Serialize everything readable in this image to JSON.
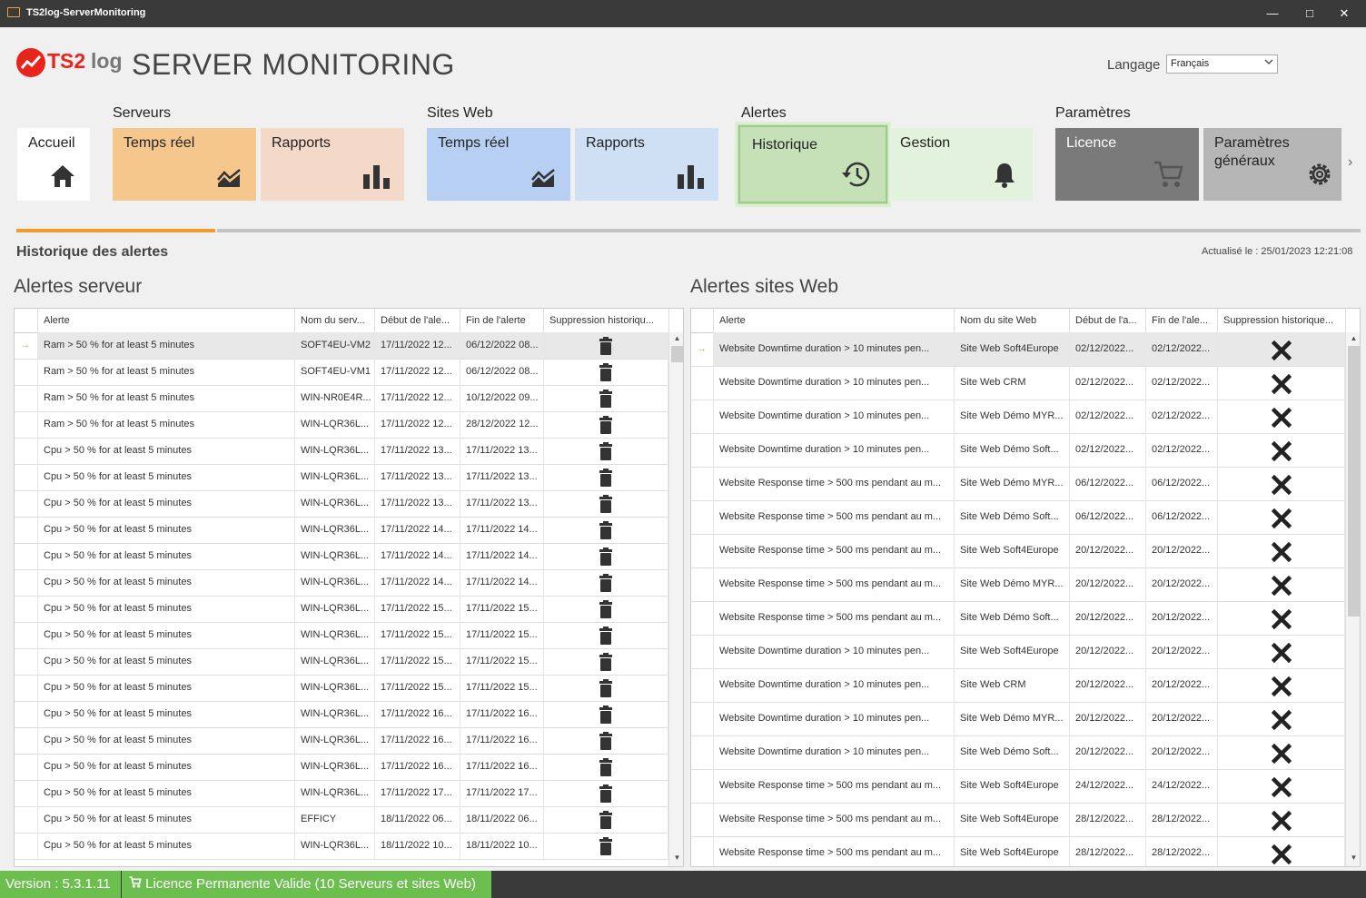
{
  "window": {
    "title": "TS2log-ServerMonitoring"
  },
  "header": {
    "logo_ts2": "TS2",
    "logo_log": "log",
    "title": "SERVER MONITORING",
    "language_label": "Langage",
    "language_value": "Français"
  },
  "groups": {
    "serveurs": "Serveurs",
    "sites": "Sites Web",
    "alertes": "Alertes",
    "parametres": "Paramètres"
  },
  "tiles": {
    "accueil": "Accueil",
    "srv_temps_reel": "Temps réel",
    "srv_rapports": "Rapports",
    "web_temps_reel": "Temps réel",
    "web_rapports": "Rapports",
    "historique": "Historique",
    "gestion": "Gestion",
    "licence": "Licence",
    "parametres_1": "Paramètres",
    "parametres_2": "généraux"
  },
  "colors": {
    "orange_tile": "#f6c78d",
    "orange_light": "#f4d9c8",
    "blue_tile": "#b6cff3",
    "blue_light": "#cfe0f5",
    "green_tile": "#c6e0b8",
    "green_light": "#e2f2dc",
    "grey_tile": "#7a7a7a",
    "grey_light": "#b6b6b6",
    "accent": "#f09b2b",
    "status_green": "#6cbf4f"
  },
  "section": {
    "title": "Historique des alertes",
    "updated": "Actualisé le : 25/01/2023 12:21:08"
  },
  "server_alerts": {
    "title": "Alertes serveur",
    "headers": [
      "Alerte",
      "Nom du serv...",
      "Début de l'ale...",
      "Fin de l'alerte",
      "Suppression historiqu..."
    ],
    "rows": [
      [
        "Ram > 50 % for at least 5 minutes",
        "SOFT4EU-VM2",
        "17/11/2022 12...",
        "06/12/2022 08..."
      ],
      [
        "Ram > 50 % for at least 5 minutes",
        "SOFT4EU-VM1",
        "17/11/2022 12...",
        "06/12/2022 08..."
      ],
      [
        "Ram > 50 % for at least 5 minutes",
        "WIN-NR0E4R...",
        "17/11/2022 12...",
        "10/12/2022 09..."
      ],
      [
        "Ram > 50 % for at least 5 minutes",
        "WIN-LQR36L...",
        "17/11/2022 12...",
        "28/12/2022 12..."
      ],
      [
        "Cpu > 50 % for at least 5 minutes",
        "WIN-LQR36L...",
        "17/11/2022 13...",
        "17/11/2022 13..."
      ],
      [
        "Cpu > 50 % for at least 5 minutes",
        "WIN-LQR36L...",
        "17/11/2022 13...",
        "17/11/2022 13..."
      ],
      [
        "Cpu > 50 % for at least 5 minutes",
        "WIN-LQR36L...",
        "17/11/2022 13...",
        "17/11/2022 13..."
      ],
      [
        "Cpu > 50 % for at least 5 minutes",
        "WIN-LQR36L...",
        "17/11/2022 14...",
        "17/11/2022 14..."
      ],
      [
        "Cpu > 50 % for at least 5 minutes",
        "WIN-LQR36L...",
        "17/11/2022 14...",
        "17/11/2022 14..."
      ],
      [
        "Cpu > 50 % for at least 5 minutes",
        "WIN-LQR36L...",
        "17/11/2022 14...",
        "17/11/2022 14..."
      ],
      [
        "Cpu > 50 % for at least 5 minutes",
        "WIN-LQR36L...",
        "17/11/2022 15...",
        "17/11/2022 15..."
      ],
      [
        "Cpu > 50 % for at least 5 minutes",
        "WIN-LQR36L...",
        "17/11/2022 15...",
        "17/11/2022 15..."
      ],
      [
        "Cpu > 50 % for at least 5 minutes",
        "WIN-LQR36L...",
        "17/11/2022 15...",
        "17/11/2022 15..."
      ],
      [
        "Cpu > 50 % for at least 5 minutes",
        "WIN-LQR36L...",
        "17/11/2022 15...",
        "17/11/2022 15..."
      ],
      [
        "Cpu > 50 % for at least 5 minutes",
        "WIN-LQR36L...",
        "17/11/2022 16...",
        "17/11/2022 16..."
      ],
      [
        "Cpu > 50 % for at least 5 minutes",
        "WIN-LQR36L...",
        "17/11/2022 16...",
        "17/11/2022 16..."
      ],
      [
        "Cpu > 50 % for at least 5 minutes",
        "WIN-LQR36L...",
        "17/11/2022 16...",
        "17/11/2022 16..."
      ],
      [
        "Cpu > 50 % for at least 5 minutes",
        "WIN-LQR36L...",
        "17/11/2022 17...",
        "17/11/2022 17..."
      ],
      [
        "Cpu > 50 % for at least 5 minutes",
        "EFFICY",
        "18/11/2022 06...",
        "18/11/2022 06..."
      ],
      [
        "Cpu > 50 % for at least 5 minutes",
        "WIN-LQR36L...",
        "18/11/2022 10...",
        "18/11/2022 10..."
      ]
    ]
  },
  "web_alerts": {
    "title": "Alertes sites Web",
    "headers": [
      "Alerte",
      "Nom du site Web",
      "Début de l'a...",
      "Fin de l'ale...",
      "Suppression historique..."
    ],
    "rows": [
      [
        "Website Downtime duration > 10 minutes pen...",
        "Site Web Soft4Europe",
        "02/12/2022...",
        "02/12/2022..."
      ],
      [
        "Website Downtime duration > 10 minutes pen...",
        "Site Web CRM",
        "02/12/2022...",
        "02/12/2022..."
      ],
      [
        "Website Downtime duration > 10 minutes pen...",
        "Site Web Démo MYR...",
        "02/12/2022...",
        "02/12/2022..."
      ],
      [
        "Website Downtime duration > 10 minutes pen...",
        "Site Web Démo Soft...",
        "02/12/2022...",
        "02/12/2022..."
      ],
      [
        "Website Response time > 500 ms pendant au m...",
        "Site Web Démo MYR...",
        "06/12/2022...",
        "06/12/2022..."
      ],
      [
        "Website Response time > 500 ms pendant au m...",
        "Site Web Démo Soft...",
        "06/12/2022...",
        "06/12/2022..."
      ],
      [
        "Website Response time > 500 ms pendant au m...",
        "Site Web Soft4Europe",
        "20/12/2022...",
        "20/12/2022..."
      ],
      [
        "Website Response time > 500 ms pendant au m...",
        "Site Web Démo MYR...",
        "20/12/2022...",
        "20/12/2022..."
      ],
      [
        "Website Response time > 500 ms pendant au m...",
        "Site Web Démo Soft...",
        "20/12/2022...",
        "20/12/2022..."
      ],
      [
        "Website Downtime duration > 10 minutes pen...",
        "Site Web Soft4Europe",
        "20/12/2022...",
        "20/12/2022..."
      ],
      [
        "Website Downtime duration > 10 minutes pen...",
        "Site Web CRM",
        "20/12/2022...",
        "20/12/2022..."
      ],
      [
        "Website Downtime duration > 10 minutes pen...",
        "Site Web Démo MYR...",
        "20/12/2022...",
        "20/12/2022..."
      ],
      [
        "Website Downtime duration > 10 minutes pen...",
        "Site Web Démo Soft...",
        "20/12/2022...",
        "20/12/2022..."
      ],
      [
        "Website Response time > 500 ms pendant au m...",
        "Site Web Soft4Europe",
        "24/12/2022...",
        "24/12/2022..."
      ],
      [
        "Website Response time > 500 ms pendant au m...",
        "Site Web Soft4Europe",
        "28/12/2022...",
        "28/12/2022..."
      ],
      [
        "Website Response time > 500 ms pendant au m...",
        "Site Web Soft4Europe",
        "28/12/2022...",
        "28/12/2022..."
      ]
    ]
  },
  "status": {
    "version": "Version : 5.3.1.11",
    "licence": "Licence Permanente Valide (10 Serveurs et sites Web)"
  }
}
